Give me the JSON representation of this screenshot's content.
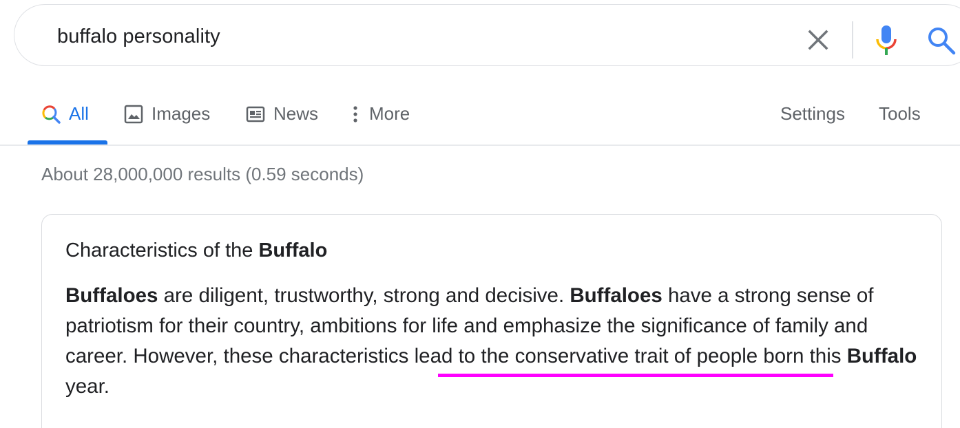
{
  "search": {
    "query": "buffalo personality"
  },
  "tabs": {
    "all": "All",
    "images": "Images",
    "news": "News",
    "more": "More",
    "settings": "Settings",
    "tools": "Tools"
  },
  "results_stats": "About 28,000,000 results (0.59 seconds)",
  "snippet": {
    "title_prefix": "Characteristics of the ",
    "title_bold": "Buffalo",
    "body": [
      {
        "text": "Buffaloes",
        "bold": true
      },
      {
        "text": " are diligent, trustworthy, strong and decisive. ",
        "bold": false
      },
      {
        "text": "Buffaloes",
        "bold": true
      },
      {
        "text": " have a strong sense of patriotism for their country, ambitions for life and emphasize the significance of family and career. However, these characteristics lead to the conservative trait of people born this ",
        "bold": false
      },
      {
        "text": "Buffalo",
        "bold": true
      },
      {
        "text": " year.",
        "bold": false
      }
    ]
  },
  "colors": {
    "accent_blue": "#1a73e8",
    "highlight_magenta": "#ff00ff"
  },
  "icons": {
    "clear": "close-icon",
    "mic": "microphone-icon",
    "search": "search-icon",
    "images": "image-icon",
    "news": "newspaper-icon",
    "more": "vertical-dots-icon"
  }
}
